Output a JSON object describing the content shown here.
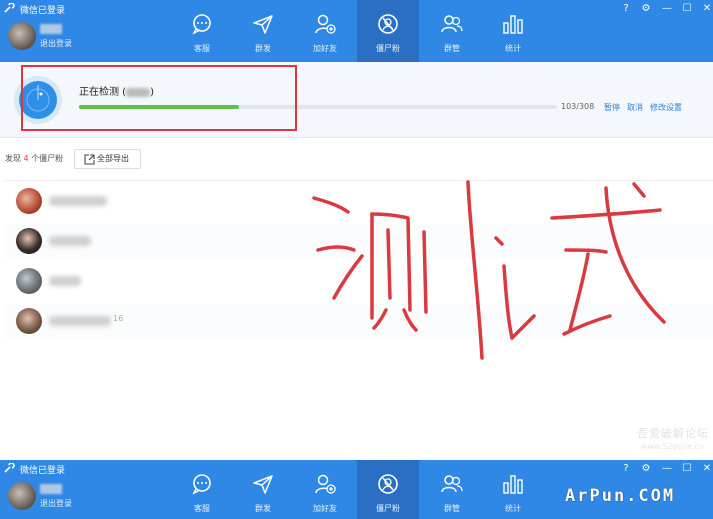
{
  "window": {
    "title": "微信已登录",
    "logout": "退出登录",
    "controls": [
      "?",
      "⚙",
      "—",
      "☐",
      "✕"
    ]
  },
  "nav": [
    {
      "label": "客服",
      "icon": "chat-bubble-icon",
      "active": false
    },
    {
      "label": "群发",
      "icon": "paper-plane-icon",
      "active": false
    },
    {
      "label": "加好友",
      "icon": "add-friend-icon",
      "active": false
    },
    {
      "label": "僵尸粉",
      "icon": "zombie-fan-icon",
      "active": true
    },
    {
      "label": "群管",
      "icon": "group-manage-icon",
      "active": false
    },
    {
      "label": "统计",
      "icon": "bar-chart-icon",
      "active": false
    }
  ],
  "scan": {
    "title": "正在检测 (",
    "title_end": ")",
    "progress_count": "103/308",
    "progress_fraction": 0.334,
    "actions": [
      "暂停",
      "取消",
      "修改设置"
    ]
  },
  "results": {
    "found_prefix": "发现",
    "found_count": "4",
    "found_suffix": "个僵尸粉",
    "export_label": "全部导出",
    "rows": [
      {
        "tail": ""
      },
      {
        "tail": ""
      },
      {
        "tail": ""
      },
      {
        "tail": "16"
      }
    ]
  },
  "annotation": {
    "handwriting": "测试"
  },
  "watermark": {
    "line1": "吾爱破解论坛",
    "line2": "www.52pojie.cn",
    "brand": "ArPun.COM"
  },
  "colors": {
    "header": "#2f88e6",
    "active_tab": "#2a6fc4",
    "progress": "#5dc14c",
    "highlight": "#e0353d",
    "link": "#2f7fdb"
  }
}
